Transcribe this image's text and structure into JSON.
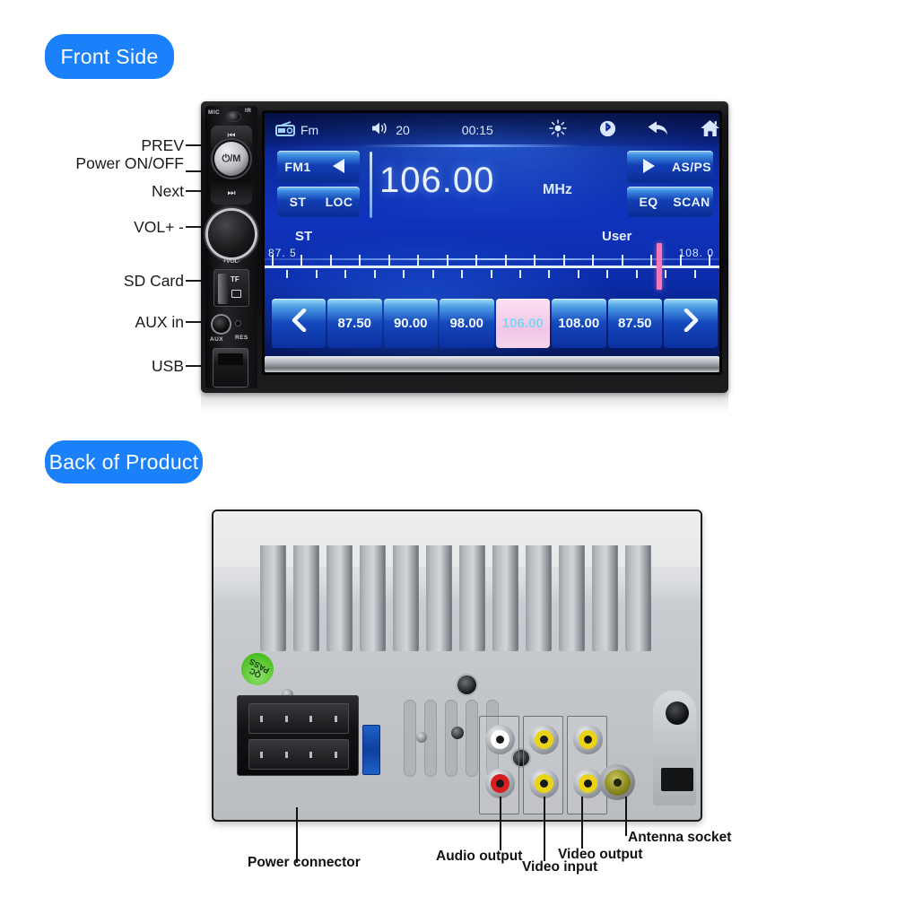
{
  "sections": {
    "front_label": "Front Side",
    "back_label": "Back of Product"
  },
  "front_callouts": [
    {
      "label": "PREV"
    },
    {
      "label": "Power ON/OFF"
    },
    {
      "label": "Next"
    },
    {
      "label": "VOL+ -"
    },
    {
      "label": "SD Card"
    },
    {
      "label": "AUX in"
    },
    {
      "label": "USB"
    }
  ],
  "device_markings": {
    "mic": "MIC",
    "ir": "IR",
    "power_knob": "⏻/M",
    "prev_glyph": "⏮",
    "next_glyph": "⏭",
    "vol": "+VOL-",
    "tf": "TF",
    "aux": "AUX",
    "res": "RES"
  },
  "screen": {
    "statusbar": {
      "source_icon": "radio-icon",
      "source": "Fm",
      "volume_icon": "speaker-icon",
      "volume": "20",
      "clock": "00:15",
      "brightness_icon": "sun-icon",
      "bluetooth_icon": "bluetooth-icon",
      "back_icon": "back-arrow-icon",
      "home_icon": "home-icon"
    },
    "tuner": {
      "band": "FM1",
      "prev_icon": "triangle-left-icon",
      "next_icon": "triangle-right-icon",
      "asps": "AS/PS",
      "st": "ST",
      "loc": "LOC",
      "eq": "EQ",
      "scan": "SCAN",
      "frequency": "106.00",
      "unit": "MHz"
    },
    "scale": {
      "st_label": "ST",
      "user_label": "User",
      "min": "87. 5",
      "max": "108. 0",
      "needle_percent": 88
    },
    "presets": {
      "prev_icon": "chevron-left-icon",
      "next_icon": "chevron-right-icon",
      "items": [
        {
          "value": "87.50",
          "active": false
        },
        {
          "value": "90.00",
          "active": false
        },
        {
          "value": "98.00",
          "active": false
        },
        {
          "value": "106.00",
          "active": true
        },
        {
          "value": "108.00",
          "active": false
        },
        {
          "value": "87.50",
          "active": false
        }
      ]
    },
    "colors": {
      "screen_blue": "#0f33bd",
      "button_blue": "#1549bd",
      "active_pink": "#f3c6e6",
      "needle_pink": "#f778b9"
    }
  },
  "back": {
    "qc_sticker": "QC PASS",
    "rca_groups": [
      {
        "name": "audio-output",
        "top_color": "#ffffff",
        "bottom_color": "#d81f20"
      },
      {
        "name": "video-input",
        "top_color": "#e8d317",
        "bottom_color": "#e8d317"
      },
      {
        "name": "video-output",
        "top_color": "#e8d317",
        "bottom_color": "#e8d317"
      }
    ],
    "callouts": [
      {
        "label": "Power connector"
      },
      {
        "label": "Audio output"
      },
      {
        "label": "Video input"
      },
      {
        "label": "Video output"
      },
      {
        "label": "Antenna socket"
      }
    ]
  },
  "theme": {
    "pill_blue": "#1a81fb"
  }
}
